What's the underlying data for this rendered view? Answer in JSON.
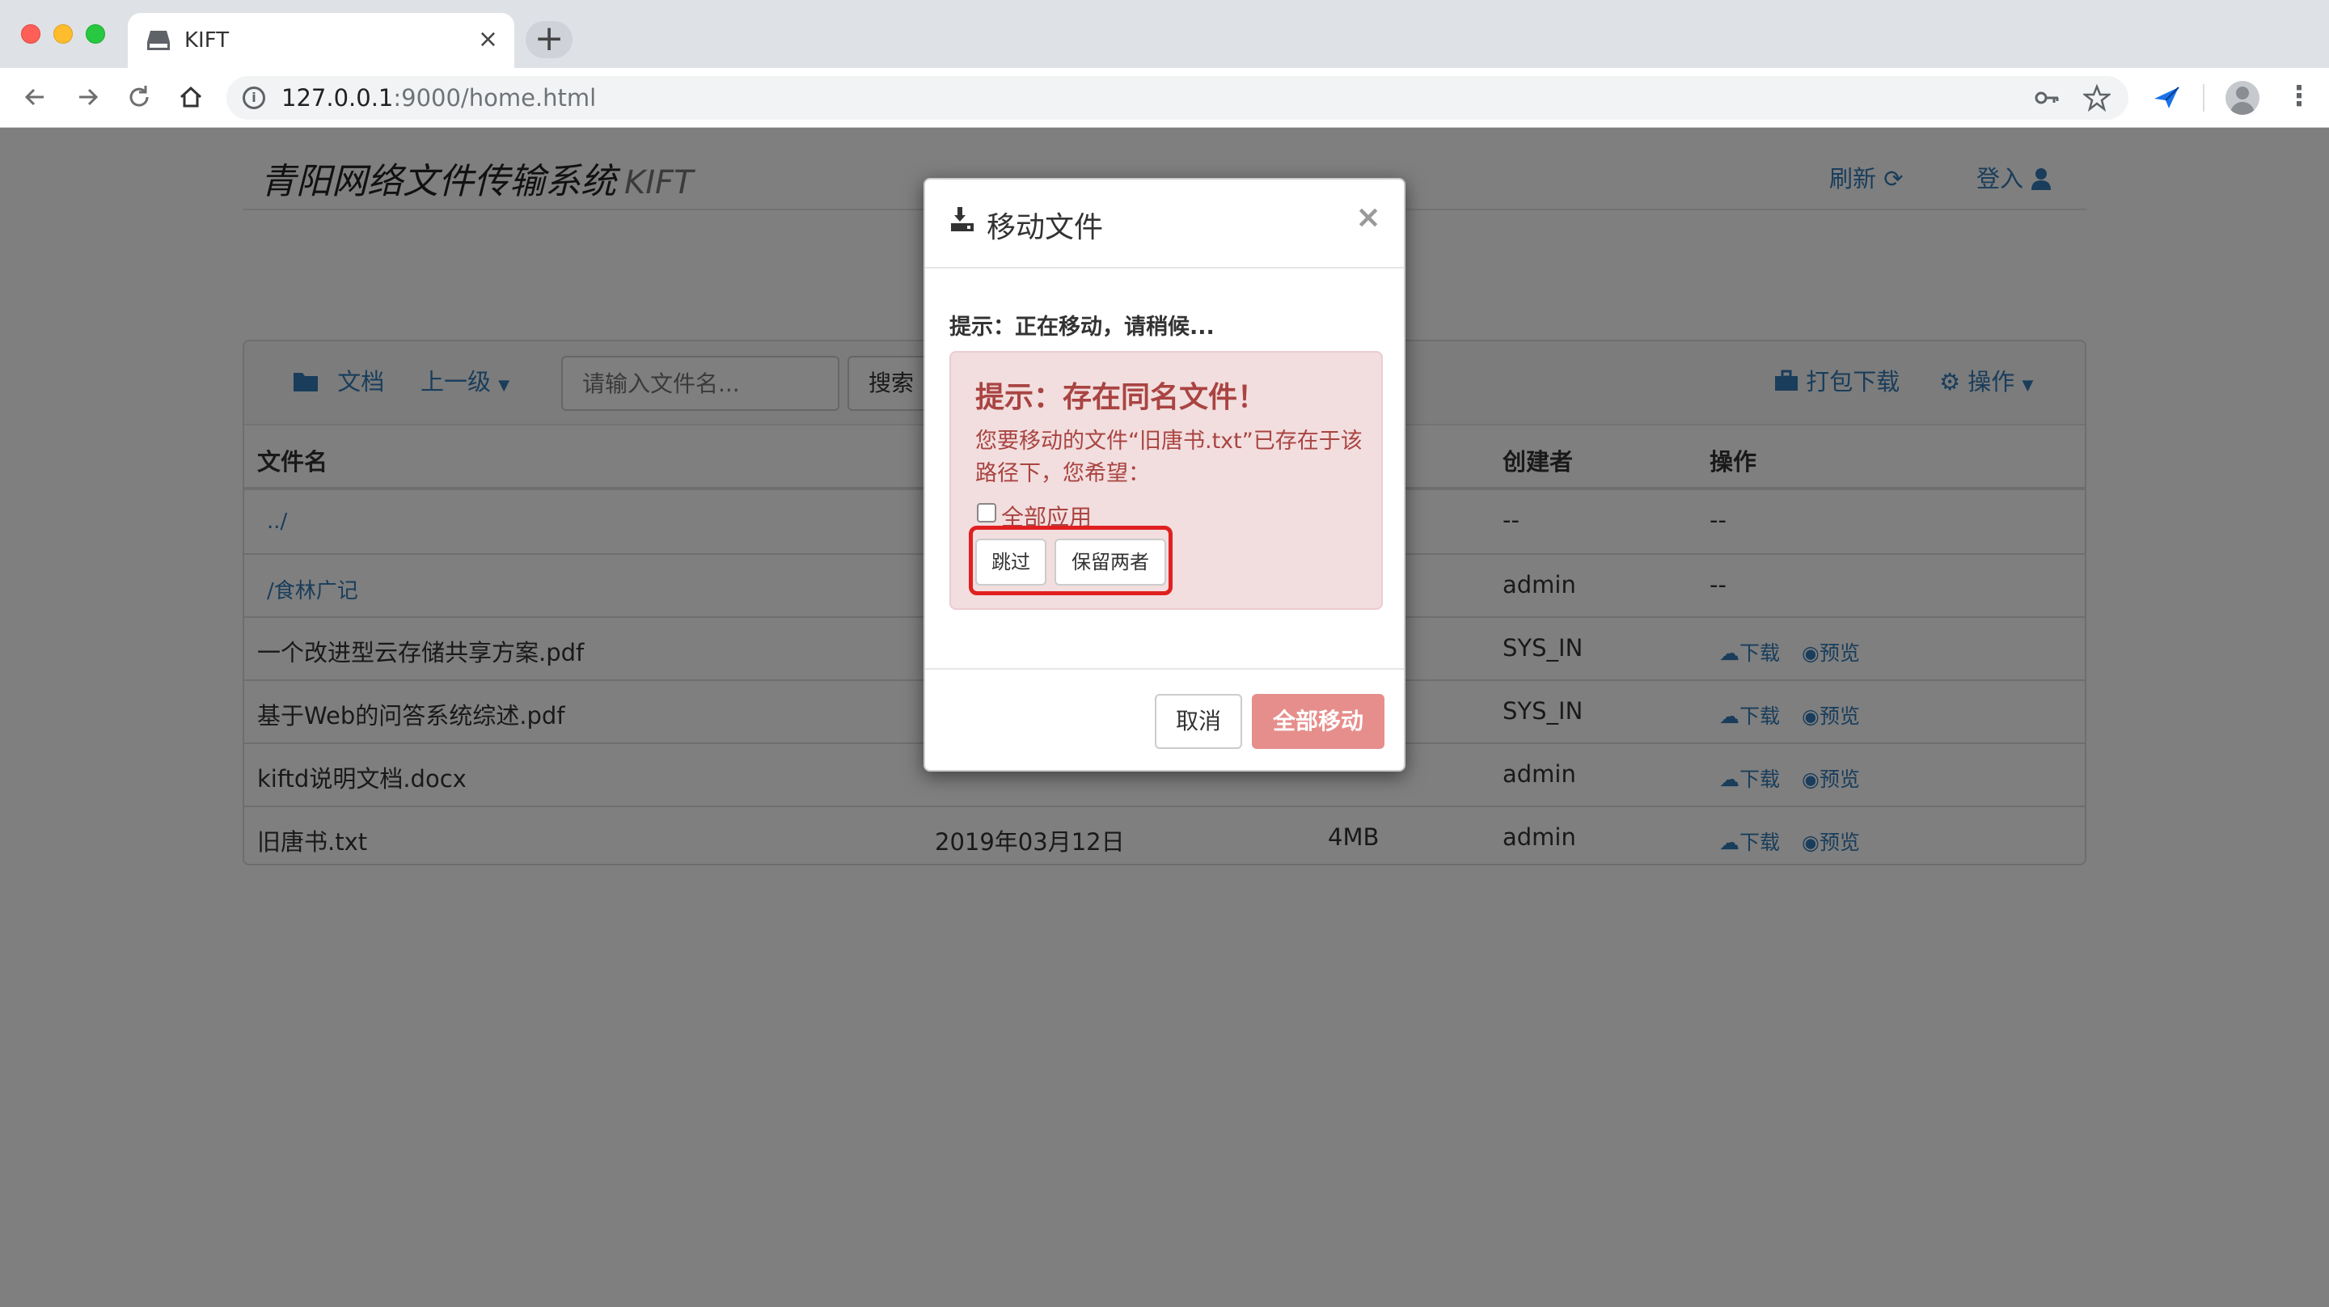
{
  "browser": {
    "tab_title": "KIFT",
    "tab_close": "×",
    "new_tab": "+",
    "url_host": "127.0.0.1",
    "url_rest": ":9000/home.html",
    "icons": [
      "back-arrow-icon",
      "forward-arrow-icon",
      "reload-icon",
      "home-icon",
      "info-icon",
      "key-icon",
      "star-icon",
      "extension-bird-icon",
      "profile-avatar-icon",
      "kebab-menu-icon"
    ]
  },
  "header": {
    "brand": "青阳网络文件传输系统",
    "brand_sub": "KIFT",
    "refresh": "刷新",
    "login": "登入"
  },
  "toolbar": {
    "folder": "文档",
    "parent": "上一级",
    "search_placeholder": "请输入文件名...",
    "search": "搜索",
    "package_download": "打包下载",
    "operations": "操作"
  },
  "table": {
    "headers": {
      "name": "文件名",
      "creator": "创建者",
      "actions": "操作"
    },
    "rows": [
      {
        "name": "../",
        "date": "",
        "size": "",
        "creator": "--",
        "actions": "--"
      },
      {
        "name": "/食林广记",
        "date": "",
        "size": "",
        "creator": "admin",
        "actions": "--"
      },
      {
        "name": "一个改进型云存储共享方案.pdf",
        "date": "",
        "size": "",
        "creator": "SYS_IN",
        "download": "下载",
        "preview": "预览"
      },
      {
        "name": "基于Web的问答系统综述.pdf",
        "date": "",
        "size": "",
        "creator": "SYS_IN",
        "download": "下载",
        "preview": "预览"
      },
      {
        "name": "kiftd说明文档.docx",
        "date": "",
        "size": "",
        "creator": "admin",
        "download": "下载",
        "preview": "预览"
      },
      {
        "name": "旧唐书.txt",
        "date": "2019年03月12日",
        "size": "4MB",
        "creator": "admin",
        "download": "下载",
        "preview": "预览"
      }
    ]
  },
  "modal": {
    "title": "移动文件",
    "close": "×",
    "tip": "提示：正在移动，请稍候...",
    "alert_title": "提示：存在同名文件！",
    "alert_text": "您要移动的文件“旧唐书.txt”已存在于该路径下，您希望：",
    "apply_all": "全部应用",
    "skip": "跳过",
    "keep_both": "保留两者",
    "cancel": "取消",
    "move_all": "全部移动"
  },
  "colors": {
    "link": "#337ab7",
    "alert_bg": "#f2dede",
    "alert_text": "#a94442",
    "danger": "#d9534f",
    "highlight": "#e02020"
  }
}
